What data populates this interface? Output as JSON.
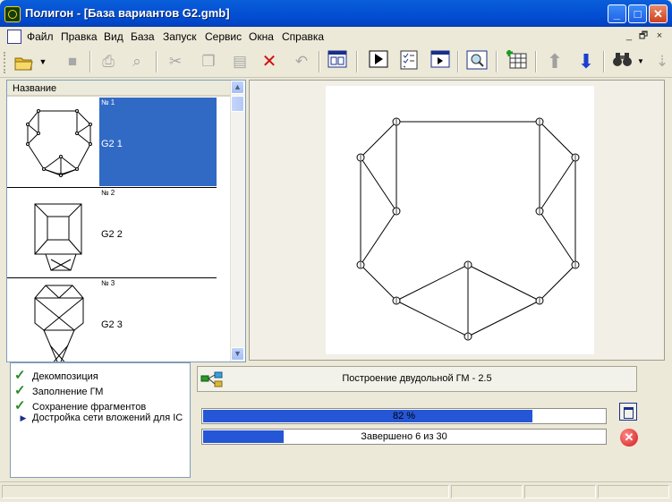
{
  "window": {
    "title": "Полигон - [База вариантов G2.gmb]",
    "minimize": "_",
    "maximize": "□",
    "close": "✕"
  },
  "menu": {
    "items": [
      "Файл",
      "Правка",
      "Вид",
      "База",
      "Запуск",
      "Сервис",
      "Окна",
      "Справка"
    ],
    "mdi_minimize": "_",
    "mdi_restore": "🗗",
    "mdi_close": "×"
  },
  "toolbar": {
    "buttons": [
      "open-folder",
      "dropdown",
      "save",
      "print",
      "print-preview",
      "cut",
      "copy",
      "paste",
      "delete",
      "undo",
      "layout",
      "run",
      "checklist",
      "window-play",
      "zoom",
      "add-grid",
      "move-up",
      "move-down",
      "binoculars",
      "more"
    ]
  },
  "list": {
    "header": "Название",
    "items": [
      {
        "num": "№ 1",
        "name": "G2 1"
      },
      {
        "num": "№ 2",
        "name": "G2 2"
      },
      {
        "num": "№ 3",
        "name": "G2 3"
      }
    ]
  },
  "steps": [
    {
      "label": "Декомпозиция",
      "done": true
    },
    {
      "label": "Заполнение ГМ",
      "done": true
    },
    {
      "label": "Сохранение фрагментов",
      "done": true
    },
    {
      "label": "Достройка сети вложений для IC",
      "done": false
    }
  ],
  "status": {
    "text": "Построение двудольной ГМ - 2.5"
  },
  "progress": [
    {
      "text": "82 %",
      "value": 0.82
    },
    {
      "text": "Завершено 6 из 30",
      "value": 0.2
    }
  ],
  "colors": {
    "accent": "#316ac5",
    "progress": "#2556d6",
    "check": "#2b8a2b"
  }
}
